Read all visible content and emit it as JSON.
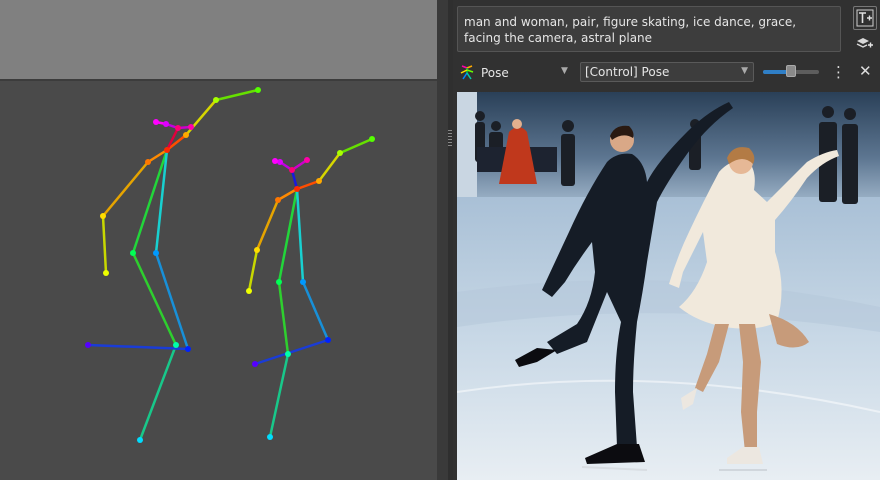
{
  "prompt": {
    "text": "man and woman, pair, figure skating, ice dance, grace, facing the camera, astral plane"
  },
  "control_layer": {
    "type_label": "Pose",
    "selected_option": "[Control] Pose",
    "strength": 0.5
  },
  "icons": {
    "add_text": "add-text-icon",
    "add_layer": "add-layer-icon",
    "pose": "pose-stickman-icon",
    "menu": "vertical-dots-icon",
    "close": "close-icon"
  },
  "colors": {
    "accent": "#2f7fc7",
    "canvas": "#4a4a4a",
    "panel": "#313131"
  }
}
